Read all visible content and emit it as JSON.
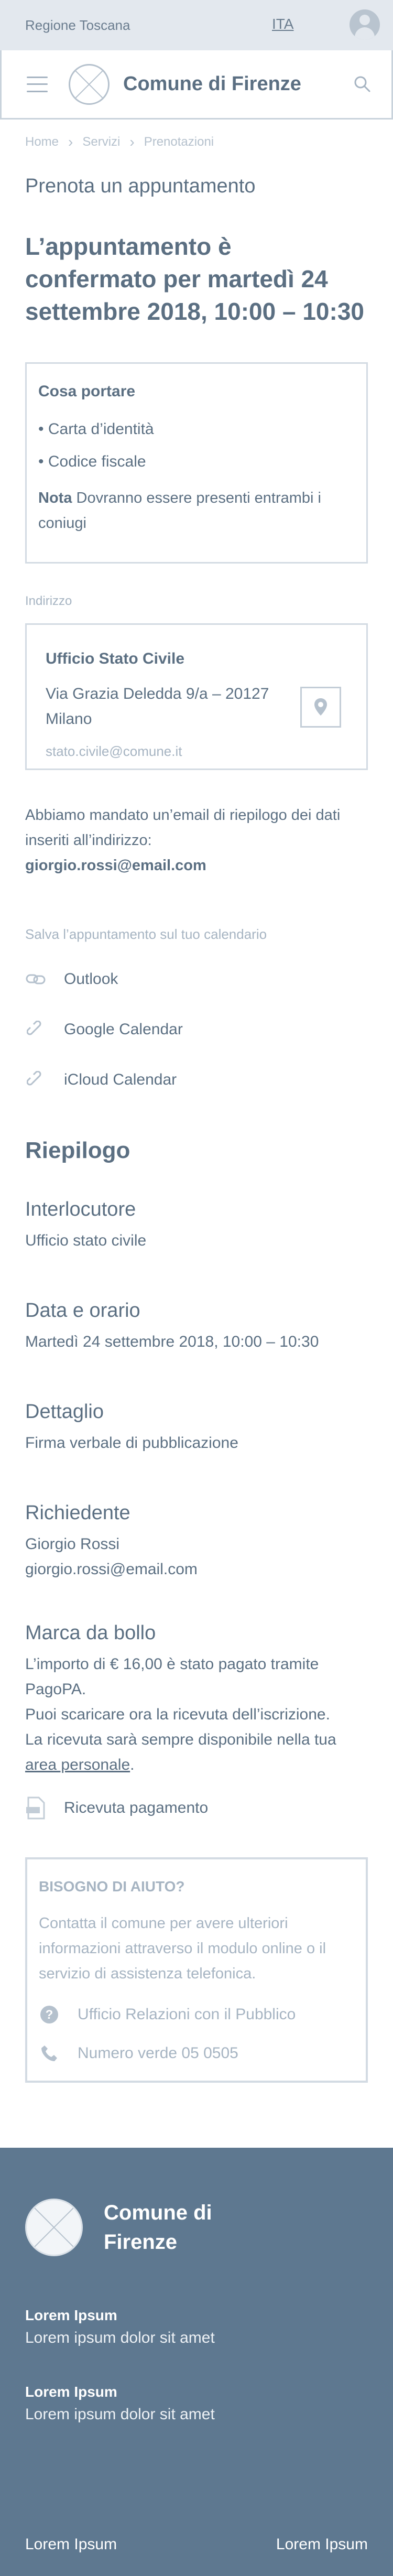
{
  "topbar": {
    "region": "Regione Toscana",
    "language": "ITA"
  },
  "header": {
    "brand": "Comune di Firenze"
  },
  "breadcrumb": {
    "items": [
      "Home",
      "Servizi",
      "Prenotazioni"
    ]
  },
  "page_title": "Prenota un appuntamento",
  "confirmation": {
    "title": "L’appuntamento è confermato per martedì 24 settembre 2018, 10:00 – 10:30"
  },
  "bring": {
    "title": "Cosa portare",
    "items": [
      "• Carta d’identità",
      "• Codice fiscale"
    ],
    "note_label": "Nota",
    "note_text": "Dovranno essere presenti entrambi i coniugi"
  },
  "address": {
    "label": "Indirizzo",
    "office": "Ufficio Stato Civile",
    "street": "Via Grazia Deledda 9/a – 20127",
    "city": "Milano",
    "email": "stato.civile@comune.it"
  },
  "email_sent": {
    "text": "Abbiamo mandato un’email di riepilogo dei dati inseriti all’indirizzo:",
    "address": "giorgio.rossi@email.com"
  },
  "calendar": {
    "label": "Salva l’appuntamento sul tuo calendario",
    "links": [
      "Outlook",
      "Google Calendar",
      "iCloud Calendar"
    ]
  },
  "summary": {
    "title": "Riepilogo",
    "interlocutor_label": "Interlocutore",
    "interlocutor_value": "Ufficio stato civile",
    "datetime_label": "Data e orario",
    "datetime_value": "Martedì 24 settembre 2018, 10:00 – 10:30",
    "detail_label": "Dettaglio",
    "detail_value": "Firma verbale di pubblicazione",
    "requester_label": "Richiedente",
    "requester_name": "Giorgio Rossi",
    "requester_email": "giorgio.rossi@email.com",
    "stamp_label": "Marca da bollo",
    "stamp_line1": "L’importo di € 16,00 è stato pagato tramite PagoPA.",
    "stamp_line2": "Puoi scaricare ora la ricevuta dell’iscrizione.",
    "stamp_line3": "La ricevuta sarà sempre disponibile nella tua",
    "stamp_link": "area personale",
    "receipt_link": "Ricevuta pagamento"
  },
  "help": {
    "title": "BISOGNO DI AIUTO?",
    "text": "Contatta il comune per avere ulteriori informazioni attraverso il modulo online o il servizio di assistenza telefonica.",
    "office_link": "Ufficio Relazioni con il Pubblico",
    "phone_link": "Numero verde 05 0505"
  },
  "footer": {
    "brand": "Comune di Firenze",
    "blocks": [
      {
        "title": "Lorem Ipsum",
        "text": "Lorem ipsum dolor sit amet"
      },
      {
        "title": "Lorem Ipsum",
        "text": "Lorem ipsum dolor sit amet"
      }
    ],
    "bottom_left": "Lorem Ipsum",
    "bottom_right": "Lorem Ipsum"
  },
  "colors": {
    "primary_text": "#5b6f82",
    "muted_text": "#a6b4c2",
    "footer_bg": "#5e7890",
    "topbar_bg": "#e3e8ee"
  }
}
